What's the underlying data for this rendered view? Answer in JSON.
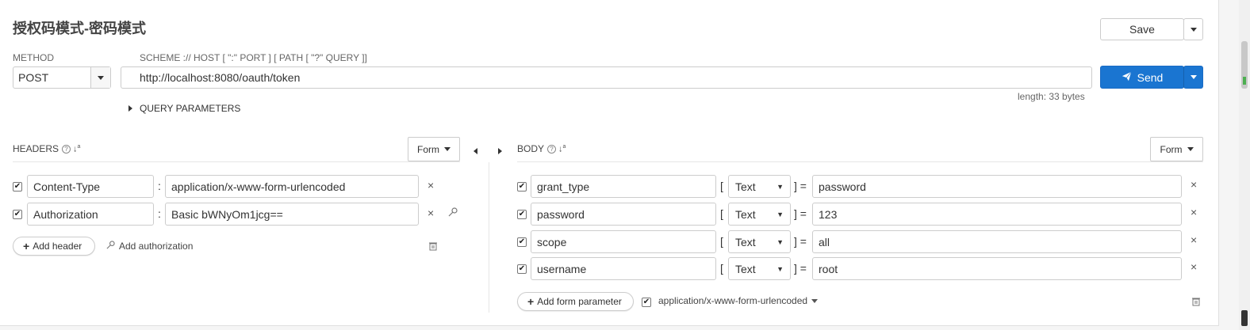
{
  "request_name": "授权码模式-密码模式",
  "toolbar": {
    "save_label": "Save",
    "send_label": "Send",
    "send_color": "#1a75d1"
  },
  "method": {
    "label": "METHOD",
    "value": "POST"
  },
  "url": {
    "label": "SCHEME :// HOST [ \":\" PORT ] [ PATH [ \"?\" QUERY ]]",
    "value": "http://localhost:8080/oauth/token",
    "length_text": "length: 33 bytes"
  },
  "query_parameters_label": "QUERY PARAMETERS",
  "headers": {
    "title": "HEADERS",
    "mode": "Form",
    "rows": [
      {
        "key": "Content-Type",
        "value": "application/x-www-form-urlencoded",
        "checked": true
      },
      {
        "key": "Authorization",
        "value": "Basic bWNyOm1jcg==",
        "checked": true
      }
    ],
    "add_header_label": "Add header",
    "add_authorization_label": "Add authorization"
  },
  "body": {
    "title": "BODY",
    "mode": "Form",
    "rows": [
      {
        "key": "grant_type",
        "type": "Text",
        "value": "password",
        "checked": true
      },
      {
        "key": "password",
        "type": "Text",
        "value": "123",
        "checked": true
      },
      {
        "key": "scope",
        "type": "Text",
        "value": "all",
        "checked": true
      },
      {
        "key": "username",
        "type": "Text",
        "value": "root",
        "checked": true
      }
    ],
    "add_param_label": "Add form parameter",
    "content_type": "application/x-www-form-urlencoded"
  },
  "icons": {
    "help": "question-circle-icon",
    "sort": "sort-icon",
    "remove": "times-icon",
    "key": "key-icon",
    "trash": "trash-icon",
    "plus": "plus-icon",
    "send": "paper-plane-icon"
  }
}
